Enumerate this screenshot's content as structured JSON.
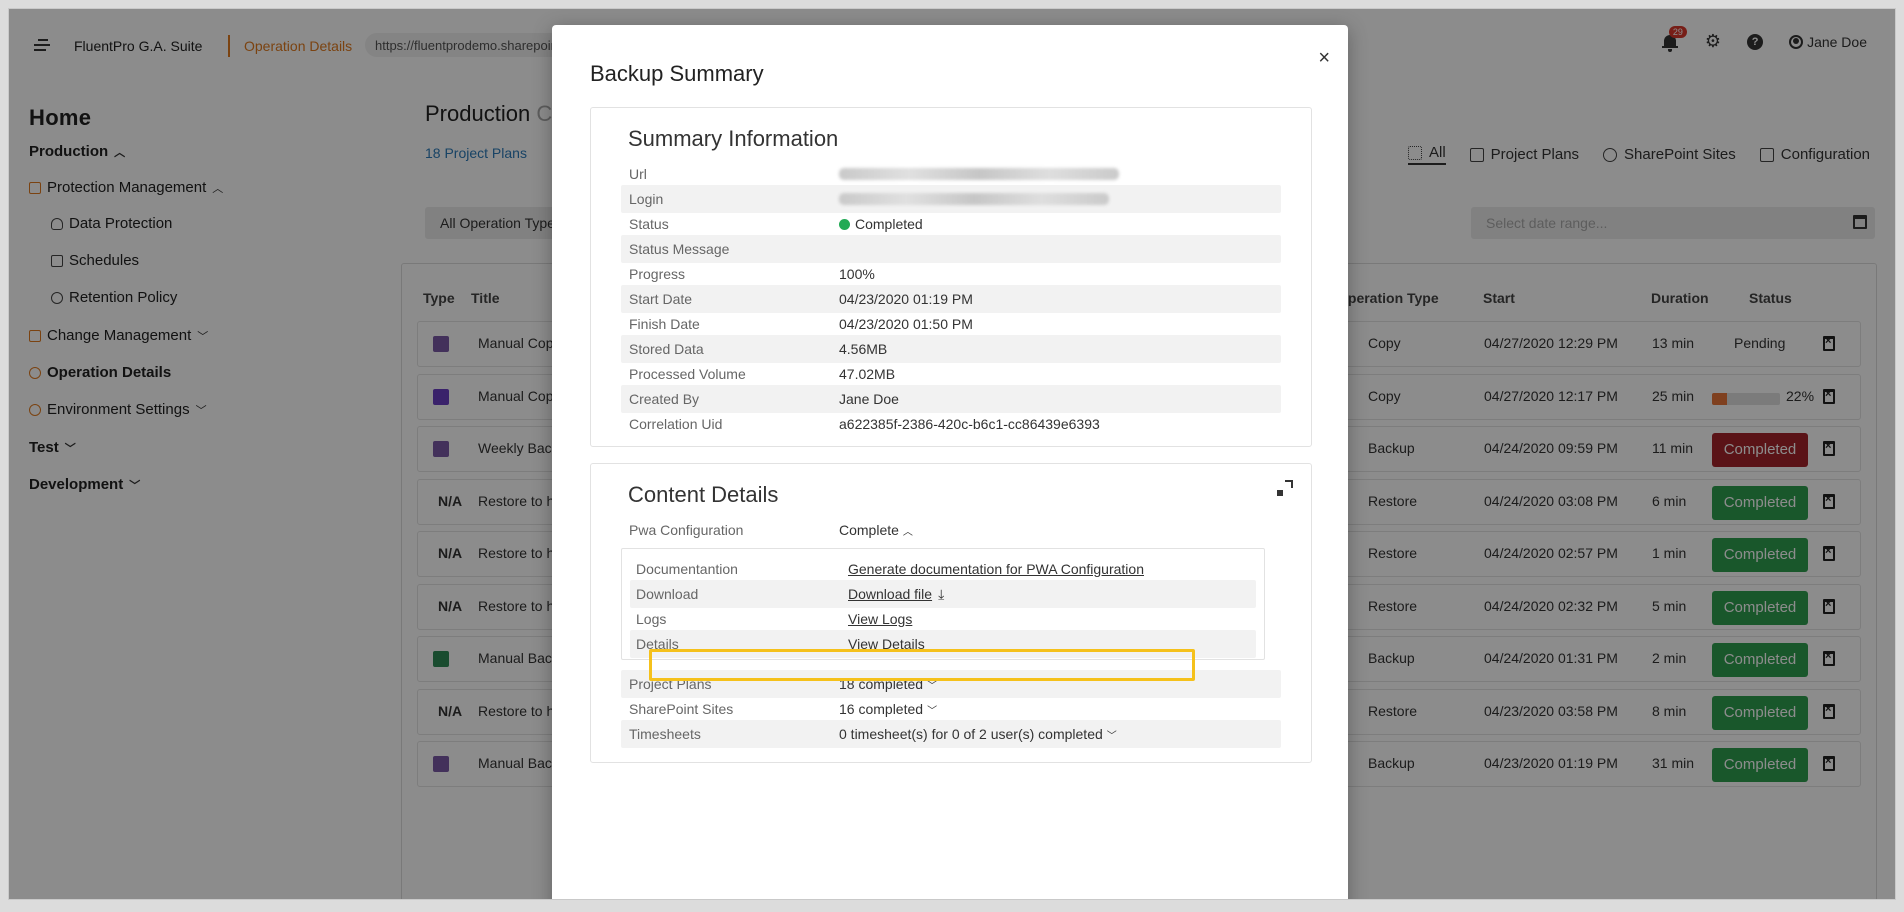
{
  "topbar": {
    "brand": "FluentPro G.A. Suite",
    "crumb": "Operation Details",
    "url": "https://fluentprodemo.sharepoint.com/sites/...",
    "notifications": "29",
    "help": "?",
    "user": "Jane Doe"
  },
  "sidebar": {
    "home": "Home",
    "production": "Production",
    "protection_management": "Protection Management",
    "data_protection": "Data Protection",
    "schedules": "Schedules",
    "retention_policy": "Retention Policy",
    "change_management": "Change Management",
    "operation_details": "Operation Details",
    "environment_settings": "Environment Settings",
    "test": "Test",
    "development": "Development"
  },
  "main": {
    "title": "Production",
    "title_suffix": "C",
    "project_count": "18 Project Plans",
    "filter_label": "All Operation Types",
    "tabs": [
      "All",
      "Project Plans",
      "SharePoint Sites",
      "Configuration"
    ],
    "date_placeholder": "Select date range...",
    "columns": [
      "Type",
      "Title",
      "Operation Type",
      "Start",
      "Duration",
      "Status"
    ],
    "rows": [
      {
        "type": "",
        "title": "Manual Cop",
        "op": "Copy",
        "start": "04/27/2020 12:29 PM",
        "duration": "13 min",
        "status": "Pending"
      },
      {
        "type": "",
        "title": "Manual Cop",
        "op": "Copy",
        "start": "04/27/2020 12:17 PM",
        "duration": "25 min",
        "status": "22%"
      },
      {
        "type": "",
        "title": "Weekly Back",
        "op": "Backup",
        "start": "04/24/2020 09:59 PM",
        "duration": "11 min",
        "status": "Completed"
      },
      {
        "type": "N/A",
        "title": "Restore to h",
        "op": "Restore",
        "start": "04/24/2020 03:08 PM",
        "duration": "6 min",
        "status": "Completed"
      },
      {
        "type": "N/A",
        "title": "Restore to h",
        "op": "Restore",
        "start": "04/24/2020 02:57 PM",
        "duration": "1 min",
        "status": "Completed"
      },
      {
        "type": "N/A",
        "title": "Restore to h",
        "op": "Restore",
        "start": "04/24/2020 02:32 PM",
        "duration": "5 min",
        "status": "Completed"
      },
      {
        "type": "",
        "title": "Manual Back",
        "op": "Backup",
        "start": "04/24/2020 01:31 PM",
        "duration": "2 min",
        "status": "Completed"
      },
      {
        "type": "N/A",
        "title": "Restore to h",
        "op": "Restore",
        "start": "04/23/2020 03:58 PM",
        "duration": "8 min",
        "status": "Completed"
      },
      {
        "type": "",
        "title": "Manual Back",
        "op": "Backup",
        "start": "04/23/2020 01:19 PM",
        "duration": "31 min",
        "status": "Completed"
      }
    ],
    "progress_fraction": 0.22
  },
  "modal": {
    "title": "Backup Summary",
    "close": "×",
    "summary": {
      "title": "Summary Information",
      "url_label": "Url",
      "login_label": "Login",
      "status_label": "Status",
      "status_value": "Completed",
      "status_message_label": "Status Message",
      "progress_label": "Progress",
      "progress_value": "100%",
      "start_label": "Start Date",
      "start_value": "04/23/2020 01:19 PM",
      "finish_label": "Finish Date",
      "finish_value": "04/23/2020 01:50 PM",
      "stored_label": "Stored Data",
      "stored_value": "4.56MB",
      "processed_label": "Processed Volume",
      "processed_value": "47.02MB",
      "created_label": "Created By",
      "created_value": "Jane Doe",
      "corr_label": "Correlation Uid",
      "corr_value": "a622385f-2386-420c-b6c1-cc86439e6393"
    },
    "content": {
      "title": "Content Details",
      "pwa_label": "Pwa Configuration",
      "pwa_value": "Complete",
      "doc_label": "Documentantion",
      "doc_value": "Generate documentation for PWA Configuration",
      "download_label": "Download",
      "download_value": "Download file",
      "logs_label": "Logs",
      "logs_value": "View Logs",
      "details_label": "Details",
      "details_value": "View Details",
      "plans_label": "Project Plans",
      "plans_value": "18 completed",
      "sites_label": "SharePoint Sites",
      "sites_value": "16 completed",
      "timesheets_label": "Timesheets",
      "timesheets_value": "0 timesheet(s) for 0 of 2 user(s) completed"
    }
  },
  "colors": {
    "accent_orange": "#e07a1f",
    "link_blue": "#2c7ab8",
    "completed_green": "#2e9e4f",
    "completed_red": "#a4232a",
    "highlight_yellow": "#f5c11b"
  }
}
